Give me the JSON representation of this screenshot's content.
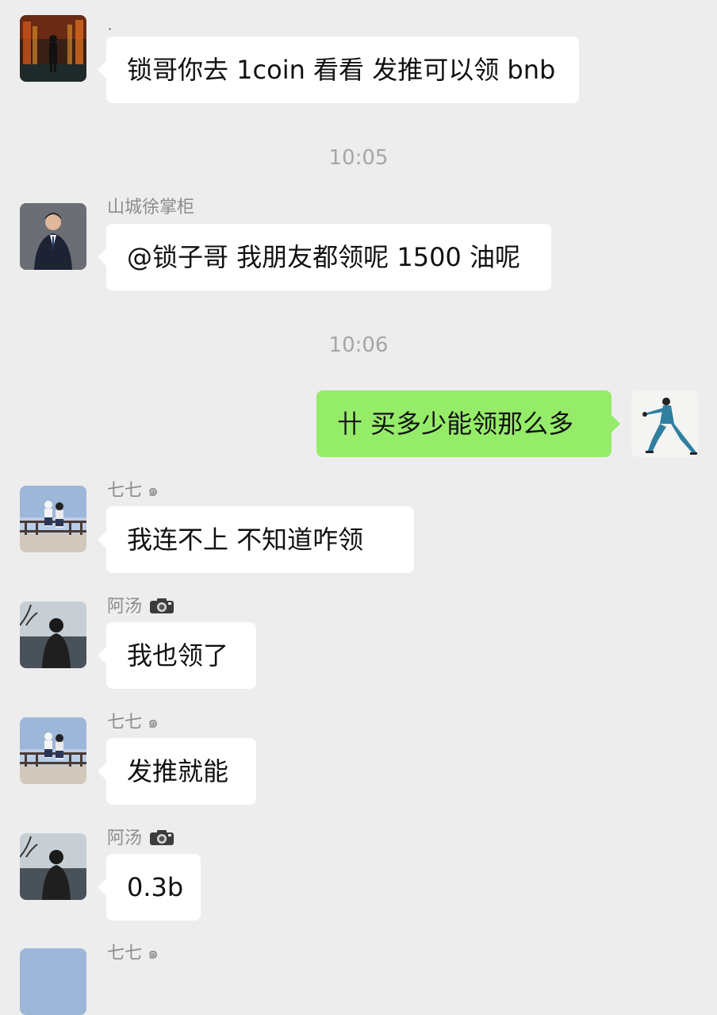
{
  "messages": [
    {
      "sender": ".",
      "text": "锁哥你去 1coin 看看 发推可以领 bnb"
    },
    {
      "time": "10:05"
    },
    {
      "sender": "山城徐掌柜",
      "text": "@锁子哥 我朋友都领呢 1500 油呢"
    },
    {
      "time": "10:06"
    },
    {
      "sender": "me",
      "text": "卄 买多少能领那么多"
    },
    {
      "sender": "七七 ๑",
      "text": "我连不上  不知道咋领"
    },
    {
      "sender": "阿汤",
      "sender_icon": "camera-icon",
      "text": "我也领了"
    },
    {
      "sender": "七七 ๑",
      "text": "发推就能"
    },
    {
      "sender": "阿汤",
      "sender_icon": "camera-icon",
      "text": "0.3b"
    },
    {
      "sender": "七七 ๑",
      "text": ""
    }
  ],
  "colors": {
    "background": "#ededed",
    "incoming_bubble": "#ffffff",
    "outgoing_bubble": "#95ec69",
    "sender_name": "#8c8c8c",
    "timestamp": "#a6a6a6"
  }
}
